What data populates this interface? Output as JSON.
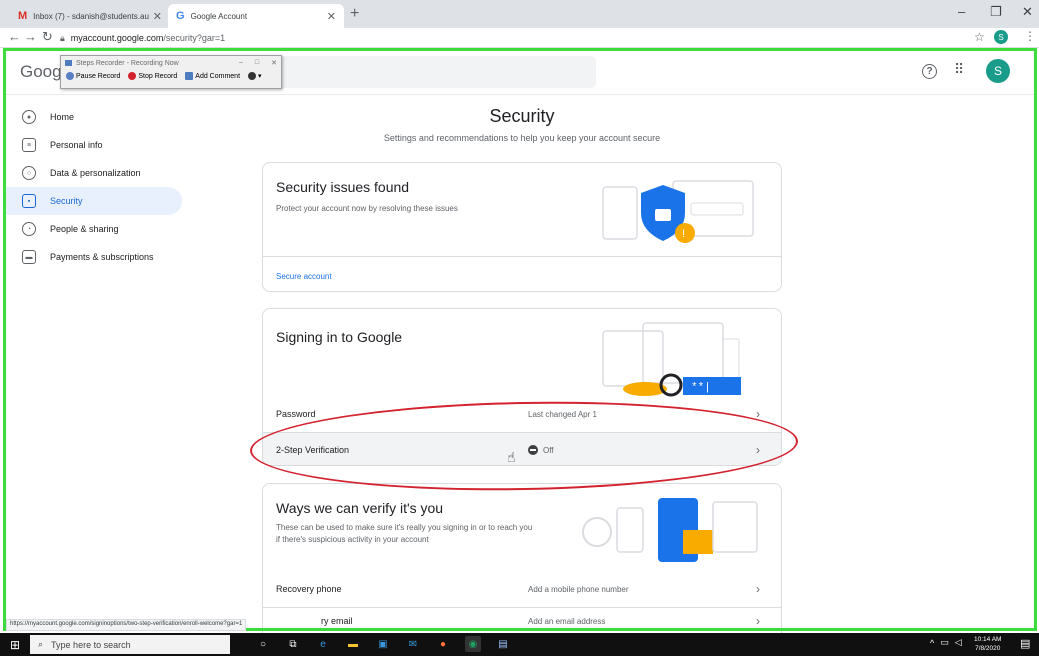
{
  "browser": {
    "tabs": [
      {
        "favicon": "M",
        "title": "Inbox (7) - sdanish@students.au"
      },
      {
        "favicon": "G",
        "title": "Google Account"
      }
    ],
    "url_host": "myaccount.google.com",
    "url_path": "/security?gar=1",
    "profile_initial": "S"
  },
  "steps_recorder": {
    "title": "Steps Recorder - Recording Now",
    "pause": "Pause Record",
    "stop": "Stop Record",
    "comment": "Add Comment"
  },
  "header": {
    "logo": "Google",
    "avatar_initial": "S"
  },
  "sidebar": {
    "items": [
      {
        "label": "Home"
      },
      {
        "label": "Personal info"
      },
      {
        "label": "Data & personalization"
      },
      {
        "label": "Security"
      },
      {
        "label": "People & sharing"
      },
      {
        "label": "Payments & subscriptions"
      }
    ]
  },
  "main": {
    "title": "Security",
    "subtitle": "Settings and recommendations to help you keep your account secure",
    "issues_card": {
      "title": "Security issues found",
      "desc": "Protect your account now by resolving these issues",
      "link": "Secure account"
    },
    "signin_card": {
      "title": "Signing in to Google",
      "rows": [
        {
          "label": "Password",
          "value": "Last changed Apr 1"
        },
        {
          "label": "2-Step Verification",
          "value": "Off"
        }
      ]
    },
    "verify_card": {
      "title": "Ways we can verify it's you",
      "desc1": "These can be used to make sure it's really you signing in or to reach you",
      "desc2": "if there's suspicious activity in your account",
      "rows": [
        {
          "label": "Recovery phone",
          "value": "Add a mobile phone number"
        },
        {
          "label": "ry email",
          "value": "Add an email address"
        }
      ]
    }
  },
  "status_url": "https://myaccount.google.com/signinoptions/two-step-verification/enroll-welcome?gar=1",
  "taskbar": {
    "search_placeholder": "Type here to search",
    "time": "10:14 AM",
    "date": "7/8/2020"
  }
}
